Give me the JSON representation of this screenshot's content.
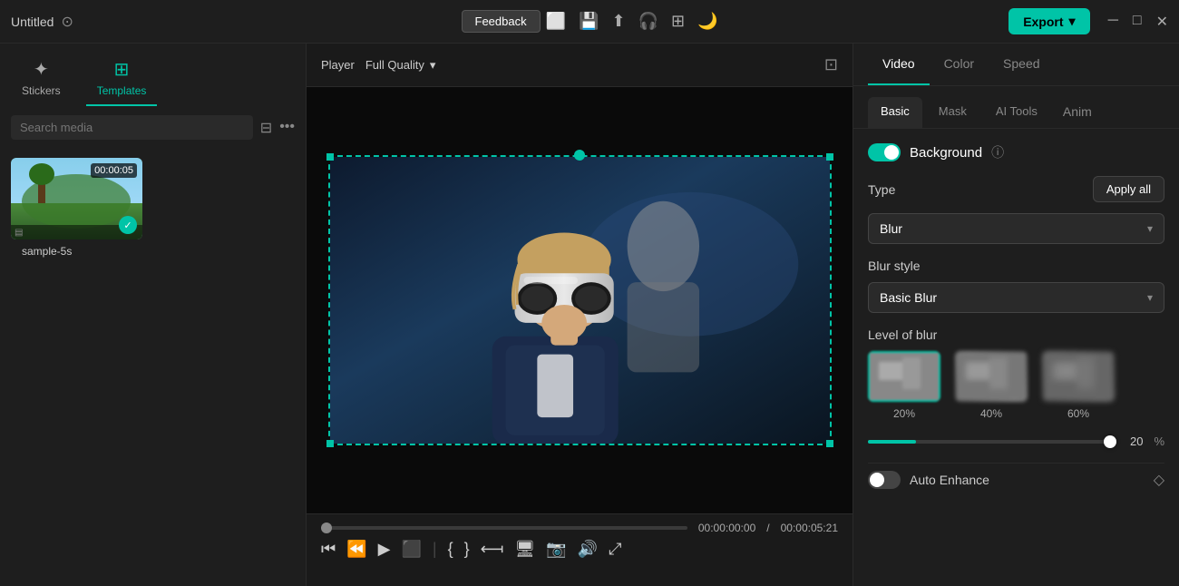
{
  "titlebar": {
    "title": "Untitled",
    "check_icon": "✓",
    "feedback_label": "Feedback",
    "export_label": "Export",
    "window_minimize": "─",
    "window_maximize": "□",
    "window_close": "✕"
  },
  "sidebar": {
    "tabs": [
      {
        "id": "stickers",
        "label": "Stickers",
        "icon": "✦",
        "active": false
      },
      {
        "id": "templates",
        "label": "Templates",
        "icon": "⊞",
        "active": true
      }
    ],
    "search_placeholder": "Search media",
    "media_items": [
      {
        "duration": "00:00:05",
        "name": "sample-5s",
        "checked": true
      }
    ]
  },
  "player": {
    "label": "Player",
    "quality": "Full Quality",
    "time_current": "00:00:00:00",
    "time_separator": "/",
    "time_total": "00:00:05:21"
  },
  "right_panel": {
    "tabs": [
      "Video",
      "Color",
      "Speed"
    ],
    "active_tab": "Video",
    "subtabs": [
      "Basic",
      "Mask",
      "AI Tools",
      "Anim"
    ],
    "active_subtab": "Basic",
    "background_label": "Background",
    "background_enabled": true,
    "type_label": "Type",
    "apply_all_label": "Apply all",
    "type_value": "Blur",
    "blur_style_label": "Blur style",
    "blur_style_value": "Basic Blur",
    "level_of_blur_label": "Level of blur",
    "blur_options": [
      {
        "pct": "20%",
        "selected": true
      },
      {
        "pct": "40%",
        "selected": false
      },
      {
        "pct": "60%",
        "selected": false
      }
    ],
    "slider_value": "20",
    "slider_unit": "%",
    "auto_enhance_label": "Auto Enhance",
    "auto_enhance_enabled": false
  }
}
